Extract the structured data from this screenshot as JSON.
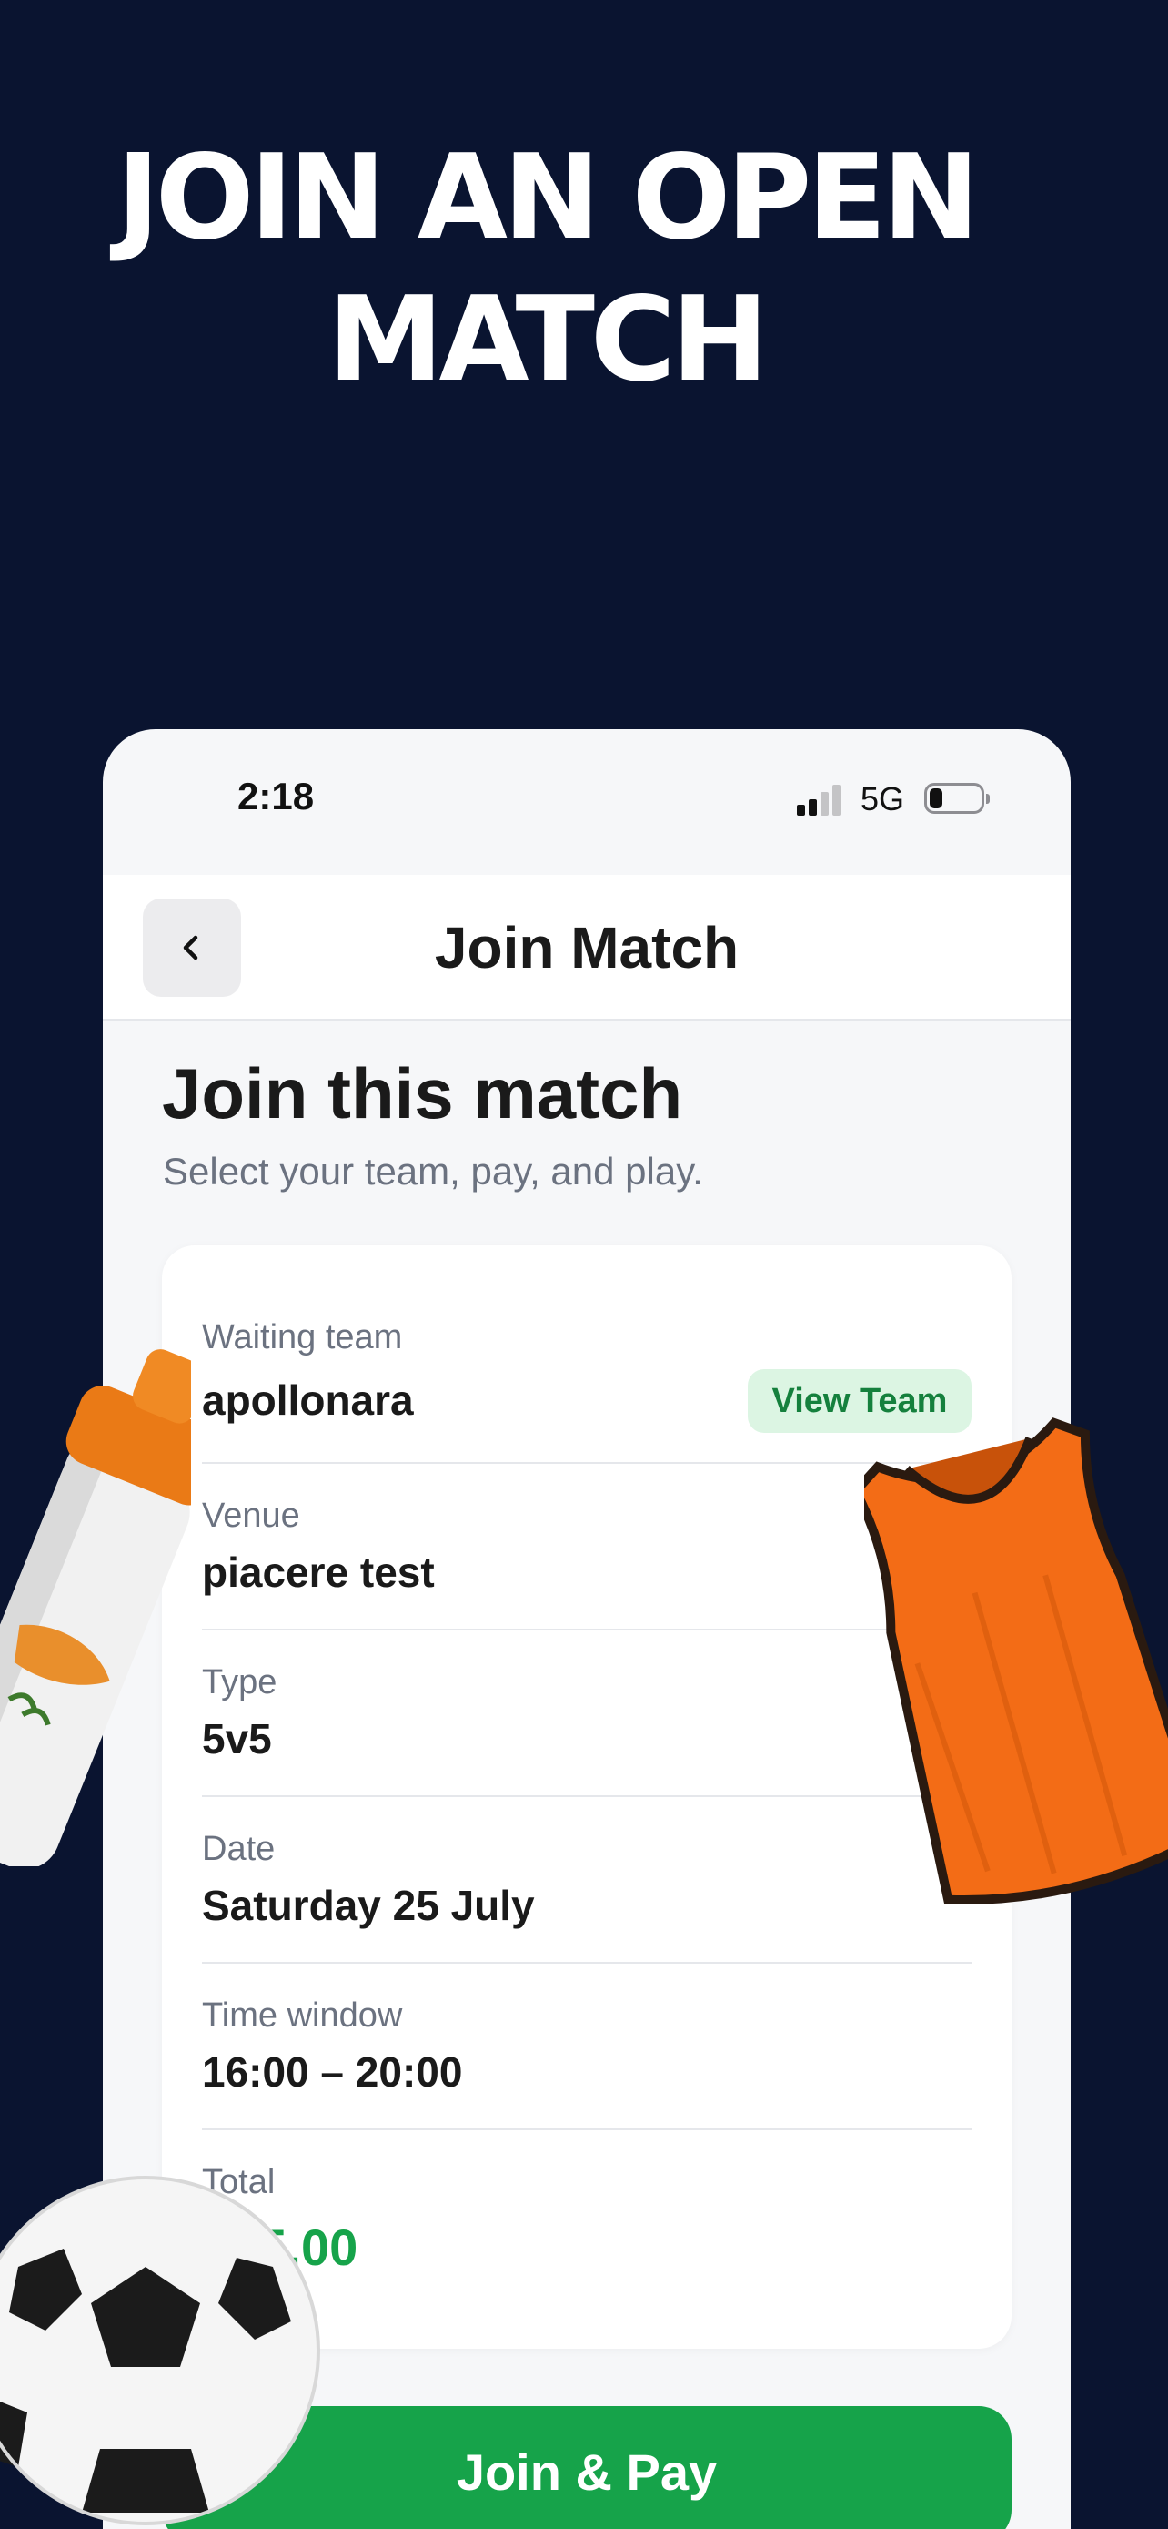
{
  "promo": {
    "title_line1": "JOIN AN OPEN",
    "title_line2": "MATCH"
  },
  "status_bar": {
    "time": "2:18",
    "network": "5G",
    "icons": [
      "signal-icon",
      "battery-icon"
    ]
  },
  "nav": {
    "back_icon": "chevron-left-icon",
    "title": "Join Match"
  },
  "header": {
    "title": "Join this match",
    "subtitle": "Select your team, pay, and play."
  },
  "match": {
    "waiting_team_label": "Waiting team",
    "waiting_team": "apollonara",
    "view_team_label": "View Team",
    "venue_label": "Venue",
    "venue": "piacere test",
    "type_label": "Type",
    "type": "5v5",
    "date_label": "Date",
    "date": "Saturday 25 July",
    "time_window_label": "Time window",
    "time_window": "16:00 – 20:00",
    "total_label": "Total",
    "total": "€35.00"
  },
  "actions": {
    "join_pay_label": "Join & Pay"
  },
  "colors": {
    "background": "#0a1430",
    "accent_green": "#16a34a",
    "badge_bg": "#dcf5e3"
  }
}
